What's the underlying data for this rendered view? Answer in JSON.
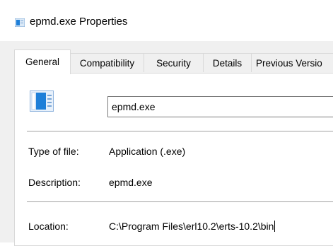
{
  "window": {
    "title": "epmd.exe Properties",
    "icon": "window-icon"
  },
  "tabs": [
    {
      "label": "General",
      "active": true
    },
    {
      "label": "Compatibility",
      "active": false
    },
    {
      "label": "Security",
      "active": false
    },
    {
      "label": "Details",
      "active": false
    },
    {
      "label": "Previous Versio",
      "active": false
    }
  ],
  "general": {
    "file_icon": "application-icon",
    "file_name": "epmd.exe",
    "type_of_file_label": "Type of file:",
    "type_of_file_value": "Application (.exe)",
    "description_label": "Description:",
    "description_value": "epmd.exe",
    "location_label": "Location:",
    "location_value": "C:\\Program Files\\erl10.2\\erts-10.2\\bin"
  },
  "colors": {
    "accent_blue": "#1e7fd8",
    "body_bg": "#f0f0f0",
    "panel_bg": "#ffffff"
  }
}
